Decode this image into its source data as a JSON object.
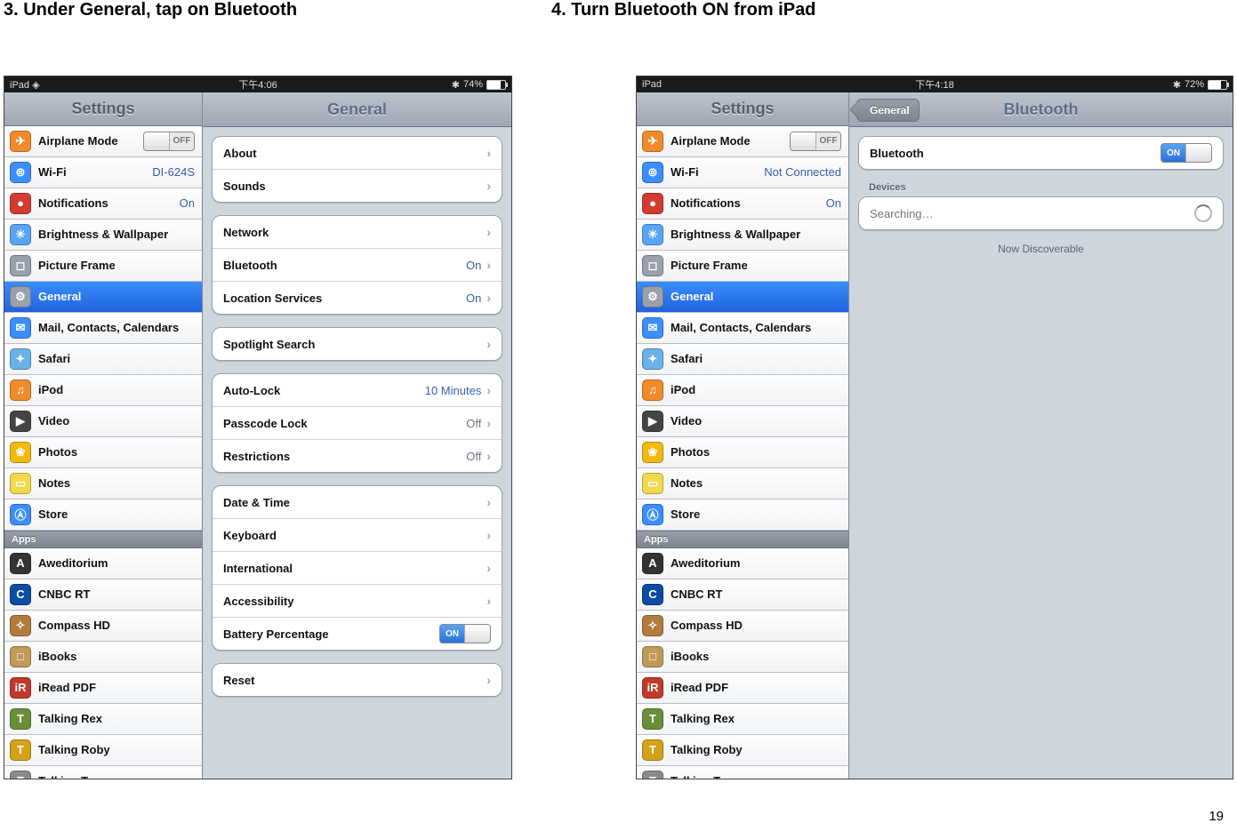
{
  "page_number": "19",
  "step3_title": "3.  Under General, tap on Bluetooth",
  "step4_title": "4.  Turn Bluetooth ON from iPad",
  "shot1": {
    "status": {
      "device": "iPad",
      "wifi": "▲",
      "time": "下午4:06",
      "bt": "*",
      "batt": "74%",
      "batt_pct": 74
    },
    "left_title": "Settings",
    "right_title": "General",
    "sidebar": [
      {
        "label": "Airplane Mode",
        "value": "",
        "toggle": "off",
        "icon": "#f08b2c",
        "glyph": "✈"
      },
      {
        "label": "Wi-Fi",
        "value": "DI-624S",
        "icon": "#3b8efb",
        "glyph": "⊚"
      },
      {
        "label": "Notifications",
        "value": "On",
        "icon": "#d23b30",
        "glyph": "●"
      },
      {
        "label": "Brightness & Wallpaper",
        "value": "",
        "icon": "#5aa4f5",
        "glyph": "☀"
      },
      {
        "label": "Picture Frame",
        "value": "",
        "icon": "#9aa0ab",
        "glyph": "◻"
      },
      {
        "label": "General",
        "value": "",
        "selected": true,
        "icon": "#9aa0ab",
        "glyph": "⚙"
      },
      {
        "label": "Mail, Contacts, Calendars",
        "value": "",
        "icon": "#3b8efb",
        "glyph": "✉"
      },
      {
        "label": "Safari",
        "value": "",
        "icon": "#6ab1ea",
        "glyph": "✦"
      },
      {
        "label": "iPod",
        "value": "",
        "icon": "#f08b2c",
        "glyph": "♫"
      },
      {
        "label": "Video",
        "value": "",
        "icon": "#444",
        "glyph": "▶"
      },
      {
        "label": "Photos",
        "value": "",
        "icon": "#f2b90c",
        "glyph": "❀"
      },
      {
        "label": "Notes",
        "value": "",
        "icon": "#f2d94c",
        "glyph": "▭"
      },
      {
        "label": "Store",
        "value": "",
        "icon": "#3b8efb",
        "glyph": "Ⓐ"
      }
    ],
    "apps_header": "Apps",
    "apps": [
      {
        "label": "Aweditorium",
        "icon": "#333",
        "glyph": "A"
      },
      {
        "label": "CNBC RT",
        "icon": "#0c4da2",
        "glyph": "C"
      },
      {
        "label": "Compass HD",
        "icon": "#b07b3c",
        "glyph": "✧"
      },
      {
        "label": "iBooks",
        "icon": "#c09a5a",
        "glyph": "□"
      },
      {
        "label": "iRead PDF",
        "icon": "#c0392b",
        "glyph": "iR"
      },
      {
        "label": "Talking Rex",
        "icon": "#6a8f3a",
        "glyph": "T"
      },
      {
        "label": "Talking Roby",
        "icon": "#d4a11a",
        "glyph": "T"
      },
      {
        "label": "Talking Tom",
        "icon": "#8a8a8a",
        "glyph": "T"
      }
    ],
    "groups": [
      [
        {
          "label": "About"
        },
        {
          "label": "Sounds"
        }
      ],
      [
        {
          "label": "Network"
        },
        {
          "label": "Bluetooth",
          "value": "On"
        },
        {
          "label": "Location Services",
          "value": "On"
        }
      ],
      [
        {
          "label": "Spotlight Search"
        }
      ],
      [
        {
          "label": "Auto-Lock",
          "value": "10 Minutes"
        },
        {
          "label": "Passcode Lock",
          "value": "Off",
          "gray": true
        },
        {
          "label": "Restrictions",
          "value": "Off",
          "gray": true
        }
      ],
      [
        {
          "label": "Date & Time"
        },
        {
          "label": "Keyboard"
        },
        {
          "label": "International"
        },
        {
          "label": "Accessibility"
        },
        {
          "label": "Battery Percentage",
          "toggle": "on"
        }
      ],
      [
        {
          "label": "Reset"
        }
      ]
    ]
  },
  "shot2": {
    "status": {
      "device": "iPad",
      "time": "下午4:18",
      "bt": "*",
      "batt": "72%",
      "batt_pct": 72
    },
    "left_title": "Settings",
    "right_title": "Bluetooth",
    "back_label": "General",
    "sidebar": [
      {
        "label": "Airplane Mode",
        "value": "",
        "toggle": "off",
        "icon": "#f08b2c",
        "glyph": "✈"
      },
      {
        "label": "Wi-Fi",
        "value": "Not Connected",
        "icon": "#3b8efb",
        "glyph": "⊚"
      },
      {
        "label": "Notifications",
        "value": "On",
        "icon": "#d23b30",
        "glyph": "●"
      },
      {
        "label": "Brightness & Wallpaper",
        "value": "",
        "icon": "#5aa4f5",
        "glyph": "☀"
      },
      {
        "label": "Picture Frame",
        "value": "",
        "icon": "#9aa0ab",
        "glyph": "◻"
      },
      {
        "label": "General",
        "value": "",
        "selected": true,
        "icon": "#9aa0ab",
        "glyph": "⚙"
      },
      {
        "label": "Mail, Contacts, Calendars",
        "value": "",
        "icon": "#3b8efb",
        "glyph": "✉"
      },
      {
        "label": "Safari",
        "value": "",
        "icon": "#6ab1ea",
        "glyph": "✦"
      },
      {
        "label": "iPod",
        "value": "",
        "icon": "#f08b2c",
        "glyph": "♫"
      },
      {
        "label": "Video",
        "value": "",
        "icon": "#444",
        "glyph": "▶"
      },
      {
        "label": "Photos",
        "value": "",
        "icon": "#f2b90c",
        "glyph": "❀"
      },
      {
        "label": "Notes",
        "value": "",
        "icon": "#f2d94c",
        "glyph": "▭"
      },
      {
        "label": "Store",
        "value": "",
        "icon": "#3b8efb",
        "glyph": "Ⓐ"
      }
    ],
    "apps_header": "Apps",
    "apps": [
      {
        "label": "Aweditorium",
        "icon": "#333",
        "glyph": "A"
      },
      {
        "label": "CNBC RT",
        "icon": "#0c4da2",
        "glyph": "C"
      },
      {
        "label": "Compass HD",
        "icon": "#b07b3c",
        "glyph": "✧"
      },
      {
        "label": "iBooks",
        "icon": "#c09a5a",
        "glyph": "□"
      },
      {
        "label": "iRead PDF",
        "icon": "#c0392b",
        "glyph": "iR"
      },
      {
        "label": "Talking Rex",
        "icon": "#6a8f3a",
        "glyph": "T"
      },
      {
        "label": "Talking Roby",
        "icon": "#d4a11a",
        "glyph": "T"
      },
      {
        "label": "Talking Tom",
        "icon": "#8a8a8a",
        "glyph": "T"
      }
    ],
    "bt_row": {
      "label": "Bluetooth",
      "toggle": "on"
    },
    "devices_caption": "Devices",
    "searching": "Searching…",
    "discover": "Now Discoverable"
  }
}
